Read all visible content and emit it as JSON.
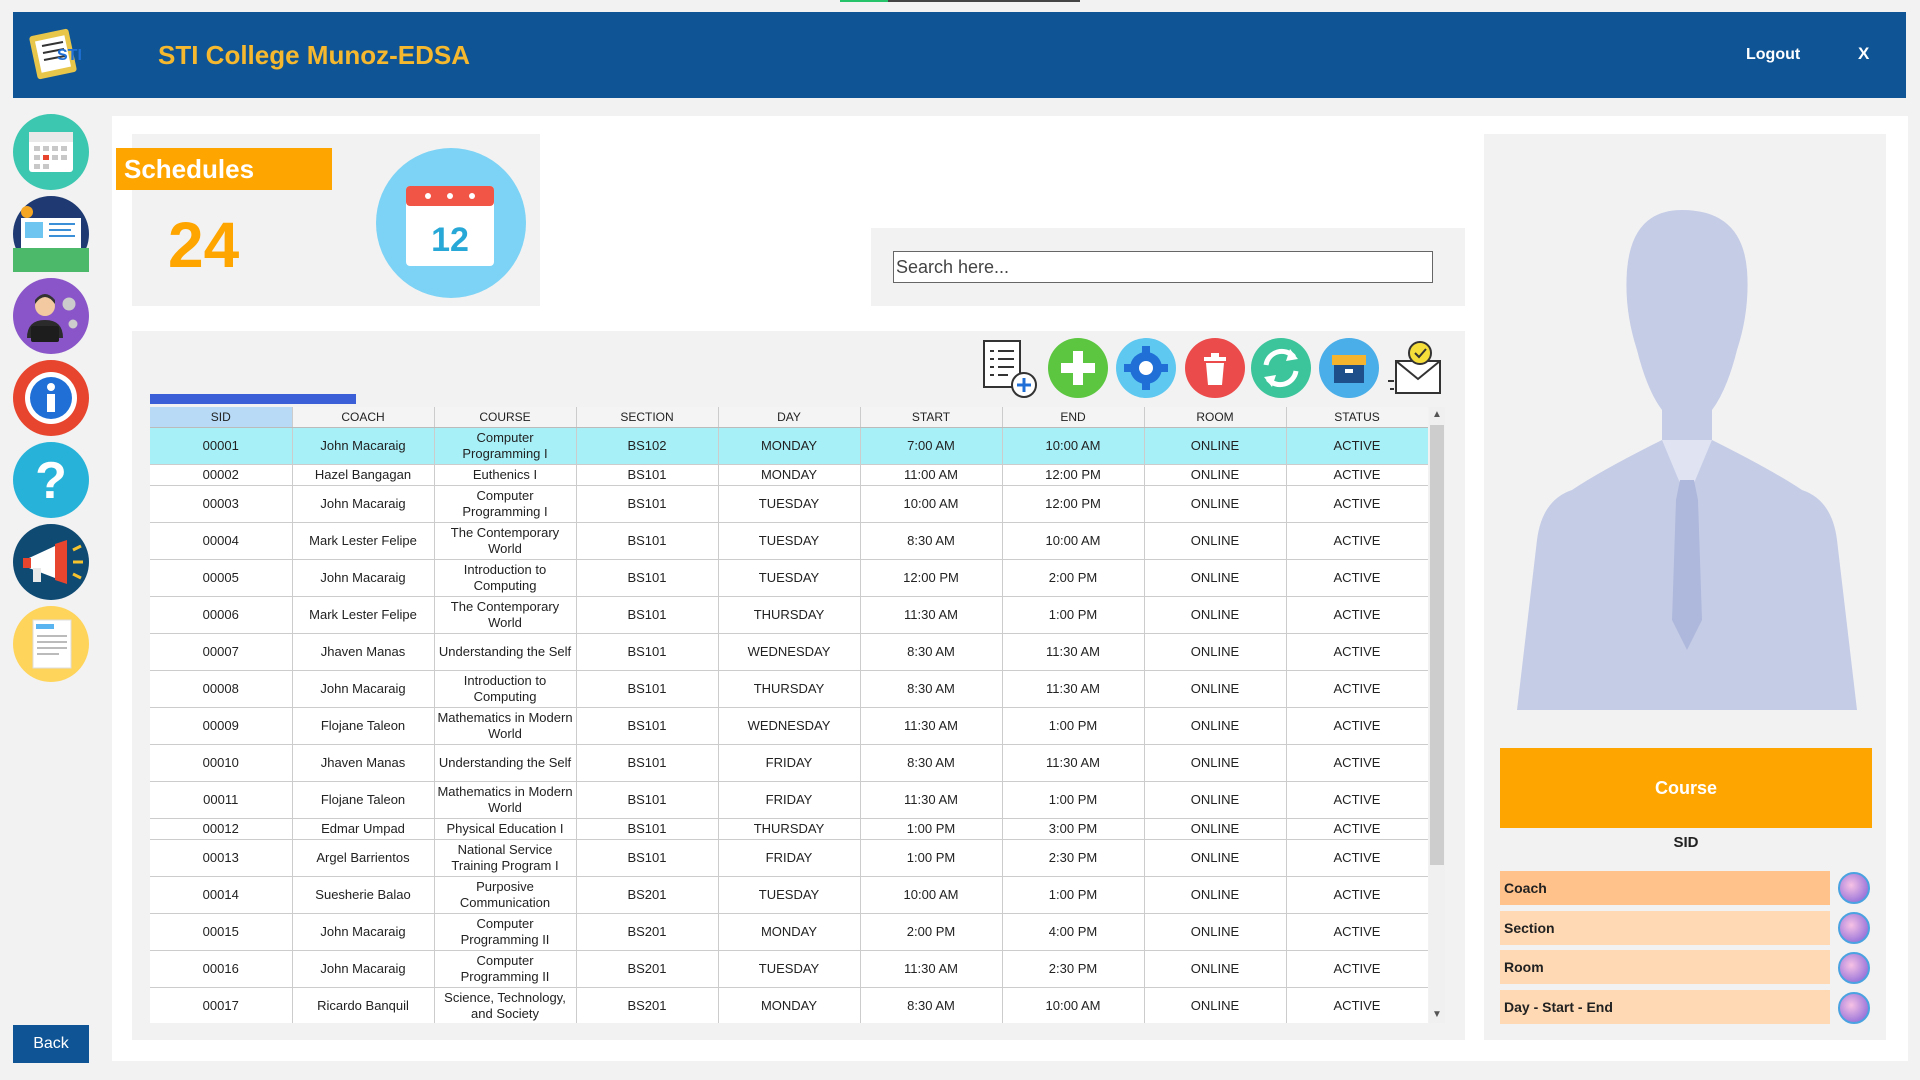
{
  "header": {
    "title": "STI College Munoz-EDSA",
    "logout_label": "Logout",
    "close_label": "X",
    "logo_text": "STI"
  },
  "sidebar": {
    "items": [
      {
        "name": "calendar-icon",
        "color": "#3cc7b0"
      },
      {
        "name": "presentation-icon",
        "color": "#1f3a72"
      },
      {
        "name": "admin-settings-icon",
        "color": "#8a55c8"
      },
      {
        "name": "info-icon",
        "color": "#e8452e"
      },
      {
        "name": "help-icon",
        "color": "#27b3d9"
      },
      {
        "name": "megaphone-icon",
        "color": "#0f4a73"
      },
      {
        "name": "report-icon",
        "color": "#ffd45a"
      }
    ],
    "back_label": "Back"
  },
  "stats": {
    "label": "Schedules",
    "count": "24",
    "calendar_day": "12"
  },
  "search": {
    "placeholder": "Search here..."
  },
  "toolbar": {
    "icons": [
      "list-add-icon",
      "add-icon",
      "settings-icon",
      "delete-icon",
      "refresh-icon",
      "archive-icon",
      "email-check-icon"
    ]
  },
  "table": {
    "columns": [
      "SID",
      "COACH",
      "COURSE",
      "SECTION",
      "DAY",
      "START",
      "END",
      "ROOM",
      "STATUS"
    ],
    "rows": [
      {
        "sid": "00001",
        "coach": "John Macaraig",
        "course": "Computer Programming I",
        "section": "BS102",
        "day": "MONDAY",
        "start": "7:00 AM",
        "end": "10:00 AM",
        "room": "ONLINE",
        "status": "ACTIVE"
      },
      {
        "sid": "00002",
        "coach": "Hazel Bangagan",
        "course": "Euthenics I",
        "section": "BS101",
        "day": "MONDAY",
        "start": "11:00 AM",
        "end": "12:00 PM",
        "room": "ONLINE",
        "status": "ACTIVE"
      },
      {
        "sid": "00003",
        "coach": "John Macaraig",
        "course": "Computer Programming I",
        "section": "BS101",
        "day": "TUESDAY",
        "start": "10:00 AM",
        "end": "12:00 PM",
        "room": "ONLINE",
        "status": "ACTIVE"
      },
      {
        "sid": "00004",
        "coach": "Mark Lester Felipe",
        "course": "The Contemporary World",
        "section": "BS101",
        "day": "TUESDAY",
        "start": "8:30 AM",
        "end": "10:00 AM",
        "room": "ONLINE",
        "status": "ACTIVE"
      },
      {
        "sid": "00005",
        "coach": "John Macaraig",
        "course": "Introduction to Computing",
        "section": "BS101",
        "day": "TUESDAY",
        "start": "12:00 PM",
        "end": "2:00 PM",
        "room": "ONLINE",
        "status": "ACTIVE"
      },
      {
        "sid": "00006",
        "coach": "Mark Lester Felipe",
        "course": "The Contemporary World",
        "section": "BS101",
        "day": "THURSDAY",
        "start": "11:30 AM",
        "end": "1:00 PM",
        "room": "ONLINE",
        "status": "ACTIVE"
      },
      {
        "sid": "00007",
        "coach": "Jhaven Manas",
        "course": "Understanding the Self",
        "section": "BS101",
        "day": "WEDNESDAY",
        "start": "8:30 AM",
        "end": "11:30 AM",
        "room": "ONLINE",
        "status": "ACTIVE"
      },
      {
        "sid": "00008",
        "coach": "John Macaraig",
        "course": "Introduction to Computing",
        "section": "BS101",
        "day": "THURSDAY",
        "start": "8:30 AM",
        "end": "11:30 AM",
        "room": "ONLINE",
        "status": "ACTIVE"
      },
      {
        "sid": "00009",
        "coach": "Flojane Taleon",
        "course": "Mathematics in Modern World",
        "section": "BS101",
        "day": "WEDNESDAY",
        "start": "11:30 AM",
        "end": "1:00 PM",
        "room": "ONLINE",
        "status": "ACTIVE"
      },
      {
        "sid": "00010",
        "coach": "Jhaven Manas",
        "course": "Understanding the Self",
        "section": "BS101",
        "day": "FRIDAY",
        "start": "8:30 AM",
        "end": "11:30 AM",
        "room": "ONLINE",
        "status": "ACTIVE"
      },
      {
        "sid": "00011",
        "coach": "Flojane Taleon",
        "course": "Mathematics in Modern World",
        "section": "BS101",
        "day": "FRIDAY",
        "start": "11:30 AM",
        "end": "1:00 PM",
        "room": "ONLINE",
        "status": "ACTIVE"
      },
      {
        "sid": "00012",
        "coach": "Edmar Umpad",
        "course": "Physical Education I",
        "section": "BS101",
        "day": "THURSDAY",
        "start": "1:00 PM",
        "end": "3:00 PM",
        "room": "ONLINE",
        "status": "ACTIVE"
      },
      {
        "sid": "00013",
        "coach": "Argel Barrientos",
        "course": "National Service Training Program I",
        "section": "BS101",
        "day": "FRIDAY",
        "start": "1:00 PM",
        "end": "2:30 PM",
        "room": "ONLINE",
        "status": "ACTIVE"
      },
      {
        "sid": "00014",
        "coach": "Suesherie Balao",
        "course": "Purposive Communication",
        "section": "BS201",
        "day": "TUESDAY",
        "start": "10:00 AM",
        "end": "1:00 PM",
        "room": "ONLINE",
        "status": "ACTIVE"
      },
      {
        "sid": "00015",
        "coach": "John Macaraig",
        "course": "Computer Programming II",
        "section": "BS201",
        "day": "MONDAY",
        "start": "2:00 PM",
        "end": "4:00 PM",
        "room": "ONLINE",
        "status": "ACTIVE"
      },
      {
        "sid": "00016",
        "coach": "John Macaraig",
        "course": "Computer Programming II",
        "section": "BS201",
        "day": "TUESDAY",
        "start": "11:30 AM",
        "end": "2:30 PM",
        "room": "ONLINE",
        "status": "ACTIVE"
      },
      {
        "sid": "00017",
        "coach": "Ricardo Banquil",
        "course": "Science, Technology, and Society",
        "section": "BS201",
        "day": "MONDAY",
        "start": "8:30 AM",
        "end": "10:00 AM",
        "room": "ONLINE",
        "status": "ACTIVE"
      }
    ]
  },
  "details": {
    "course_label": "Course",
    "sid_label": "SID",
    "fields": [
      {
        "label": "Coach",
        "color": "#ffc28a"
      },
      {
        "label": "Section",
        "color": "#ffd9b3"
      },
      {
        "label": "Room",
        "color": "#ffd9b3"
      },
      {
        "label": "Day - Start - End",
        "color": "#ffd9b3"
      }
    ]
  }
}
